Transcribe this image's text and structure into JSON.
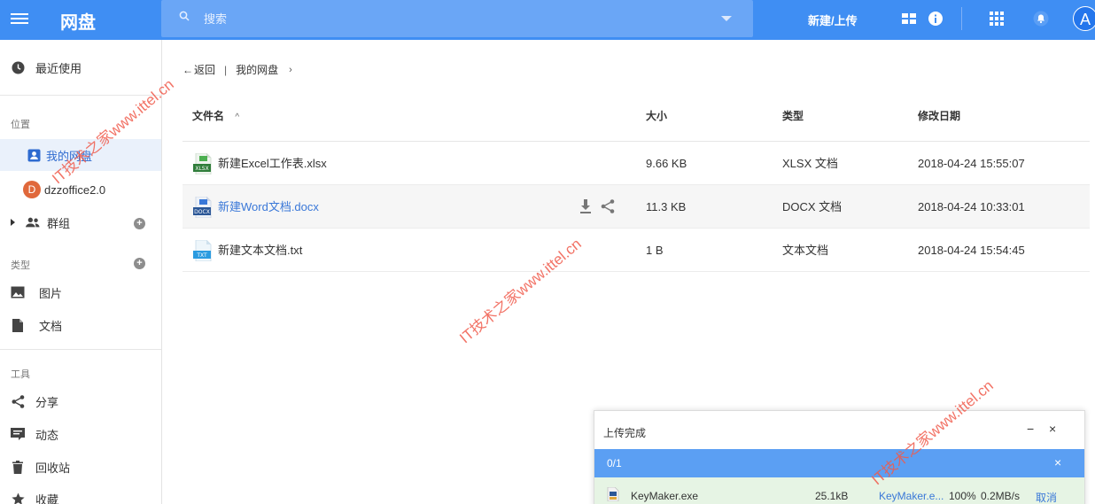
{
  "header": {
    "app_title": "网盘",
    "search_placeholder": "搜索",
    "new_upload_label": "新建/上传",
    "avatar_letter": "A"
  },
  "sidebar": {
    "recent": "最近使用",
    "section_location": "位置",
    "my_drive": "我的网盘",
    "org_initial": "D",
    "org_name": "dzzoffice2.0",
    "groups": "群组",
    "section_type": "类型",
    "pictures": "图片",
    "documents": "文档",
    "section_tools": "工具",
    "share": "分享",
    "activity": "动态",
    "recycle": "回收站",
    "favorites": "收藏"
  },
  "breadcrumb": {
    "back": "返回",
    "separator": "|",
    "current": "我的网盘",
    "chevron": "›"
  },
  "table": {
    "headers": {
      "name": "文件名",
      "sort_arrow": "^",
      "size": "大小",
      "type": "类型",
      "modified": "修改日期"
    },
    "rows": [
      {
        "name": "新建Excel工作表.xlsx",
        "size": "9.66 KB",
        "type": "XLSX 文档",
        "modified": "2018-04-24 15:55:07",
        "icon": "xlsx-icon"
      },
      {
        "name": "新建Word文档.docx",
        "size": "11.3 KB",
        "type": "DOCX 文档",
        "modified": "2018-04-24 10:33:01",
        "icon": "docx-icon"
      },
      {
        "name": "新建文本文档.txt",
        "size": "1 B",
        "type": "文本文档",
        "modified": "2018-04-24 15:54:45",
        "icon": "txt-icon"
      }
    ]
  },
  "upload_panel": {
    "title": "上传完成",
    "minimize": "−",
    "close": "×",
    "count": "0/1",
    "bar_close": "×",
    "file": {
      "name": "KeyMaker.exe",
      "size": "25.1kB",
      "target": "KeyMaker.e...",
      "progress": "100%",
      "speed": "0.2MB/s",
      "cancel": "取消"
    }
  },
  "watermark": {
    "text": "IT技术之家www.ittel.cn"
  },
  "colors": {
    "primary": "#3f8ef3",
    "link": "#3a78d8",
    "watermark": "#f05b4c",
    "upload_done": "#e6f4e4"
  }
}
